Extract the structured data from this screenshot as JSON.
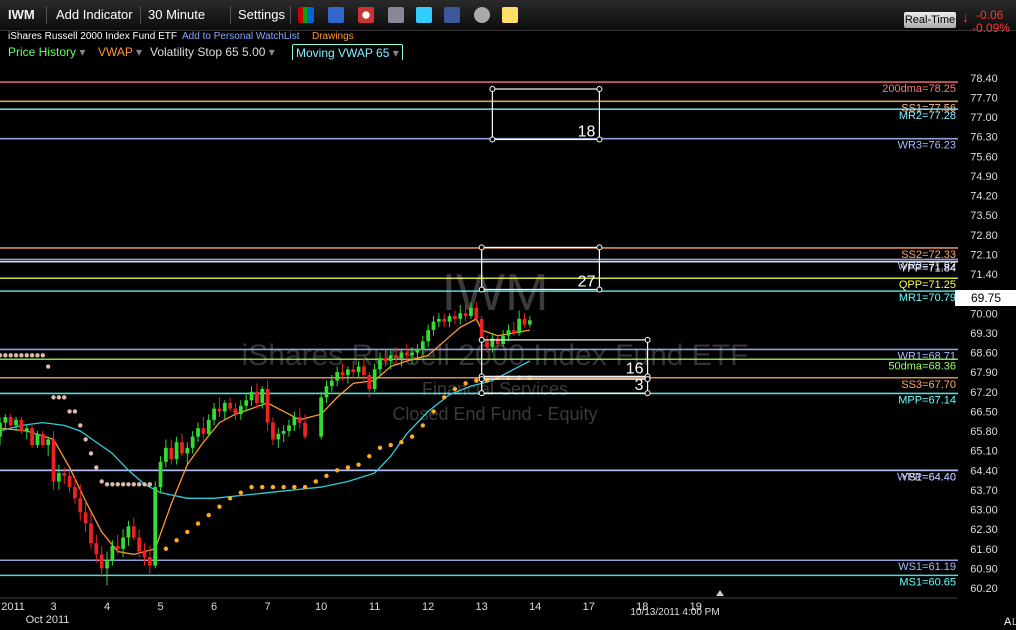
{
  "toolbar": {
    "symbol": "IWM",
    "add_indicator": "Add Indicator",
    "interval": "30 Minute",
    "settings": "Settings",
    "realtime": "Real-Time",
    "change_abs": "-0.06",
    "change_pct": "-0.09%"
  },
  "subheader": {
    "fund_name": "iShares Russell 2000 Index Fund ETF",
    "watchlist_link": "Add to Personal WatchList",
    "drawings_link": "Drawings"
  },
  "indicators": [
    {
      "label": "Price History",
      "color": "#66ff66"
    },
    {
      "label": "VWAP",
      "color": "#ff9933"
    },
    {
      "label": "Volatility Stop 65 5.00",
      "color": "#dddddd"
    },
    {
      "label": "Moving VWAP 65",
      "color": "#88eeff"
    }
  ],
  "watermark": {
    "symbol": "IWM",
    "name": "iShares Russell 2000 Index Fund ETF",
    "sector": "Financial Services",
    "industry": "Closed End Fund - Equity"
  },
  "cursor_time": "10/13/2011 4:00 PM",
  "chart_data": {
    "type": "candlestick",
    "y_range": [
      60.2,
      78.75
    ],
    "y_ticks": [
      78.4,
      77.7,
      77.0,
      76.3,
      75.6,
      74.9,
      74.2,
      73.5,
      72.8,
      72.1,
      71.4,
      70.7,
      70.0,
      69.3,
      68.6,
      67.9,
      67.2,
      66.5,
      65.8,
      65.1,
      64.4,
      63.7,
      63.0,
      62.3,
      61.6,
      60.9,
      60.2
    ],
    "x_range": [
      2.0,
      19.9
    ],
    "x_ticks": [
      {
        "x": 2.02,
        "label": "2011"
      },
      {
        "x": 3,
        "label": "3"
      },
      {
        "x": 3.0,
        "label": "Oct 2011"
      },
      {
        "x": 4,
        "label": "4"
      },
      {
        "x": 5,
        "label": "5"
      },
      {
        "x": 6,
        "label": "6"
      },
      {
        "x": 7,
        "label": "7"
      },
      {
        "x": 8,
        "label": "10"
      },
      {
        "x": 9,
        "label": "11"
      },
      {
        "x": 10,
        "label": "12"
      },
      {
        "x": 11,
        "label": "13"
      },
      {
        "x": 12,
        "label": "14"
      },
      {
        "x": 13,
        "label": "17"
      },
      {
        "x": 14,
        "label": "18"
      },
      {
        "x": 15,
        "label": "19"
      }
    ],
    "last_price": "69.75",
    "levels": [
      {
        "label": "200dma=78.25",
        "value": 78.25,
        "color": "#ff7777"
      },
      {
        "label": "SS1=77.56",
        "value": 77.56,
        "color": "#ffbb88"
      },
      {
        "label": "MR2=77.28",
        "value": 77.28,
        "color": "#88eeff"
      },
      {
        "label": "WR3=76.23",
        "value": 76.23,
        "color": "#aabbff"
      },
      {
        "label": "SS2=72.33",
        "value": 72.33,
        "color": "#ffaa66"
      },
      {
        "label": "WR2=71.92",
        "value": 71.92,
        "color": "#aabbff"
      },
      {
        "label": "YPP=71.84",
        "value": 71.84,
        "color": "#ffffff"
      },
      {
        "label": "QPP=71.25",
        "value": 71.25,
        "color": "#ffff55"
      },
      {
        "label": "MR1=70.79",
        "value": 70.79,
        "color": "#66ffff"
      },
      {
        "label": "WR1=68.71",
        "value": 68.71,
        "color": "#aabbff"
      },
      {
        "label": "50dma=68.36",
        "value": 68.36,
        "color": "#99ff66"
      },
      {
        "label": "SS3=67.70",
        "value": 67.7,
        "color": "#ffaa66"
      },
      {
        "label": "MPP=67.14",
        "value": 67.14,
        "color": "#66ffff"
      },
      {
        "label": "YS1=64.40",
        "value": 64.4,
        "color": "#ffffff"
      },
      {
        "label": "WPP=64.40",
        "value": 64.4,
        "color": "#aabbff"
      },
      {
        "label": "WS1=61.19",
        "value": 61.19,
        "color": "#aabbff"
      },
      {
        "label": "MS1=60.65",
        "value": 60.65,
        "color": "#66ffff"
      }
    ],
    "boxes": [
      {
        "label": "18",
        "x0": 11.2,
        "x1": 13.2,
        "y0": 76.2,
        "y1": 78.0
      },
      {
        "label": "27",
        "x0": 11.0,
        "x1": 13.2,
        "y0": 70.85,
        "y1": 72.35
      },
      {
        "label": "16",
        "x0": 11.0,
        "x1": 14.1,
        "y0": 67.75,
        "y1": 69.05
      },
      {
        "label": "3",
        "x0": 11.0,
        "x1": 14.1,
        "y0": 67.15,
        "y1": 67.65
      }
    ],
    "candles": [
      [
        2.0,
        65.6,
        66.3,
        65.3,
        66.1
      ],
      [
        2.1,
        66.1,
        66.4,
        65.9,
        66.3
      ],
      [
        2.2,
        66.3,
        66.4,
        65.9,
        66.0
      ],
      [
        2.3,
        66.0,
        66.3,
        65.8,
        66.2
      ],
      [
        2.4,
        66.2,
        66.3,
        65.7,
        65.8
      ],
      [
        2.5,
        65.8,
        66.0,
        65.5,
        65.9
      ],
      [
        2.6,
        65.9,
        66.0,
        65.2,
        65.3
      ],
      [
        2.7,
        65.3,
        65.8,
        65.2,
        65.7
      ],
      [
        2.8,
        65.7,
        65.8,
        65.2,
        65.3
      ],
      [
        2.9,
        65.3,
        65.6,
        64.9,
        65.5
      ],
      [
        3.0,
        65.5,
        65.8,
        63.7,
        64.0
      ],
      [
        3.1,
        64.0,
        64.6,
        63.7,
        64.3
      ],
      [
        3.2,
        64.3,
        64.5,
        63.9,
        64.2
      ],
      [
        3.3,
        64.2,
        64.4,
        63.6,
        63.8
      ],
      [
        3.4,
        63.8,
        64.2,
        63.2,
        63.4
      ],
      [
        3.5,
        63.4,
        63.9,
        62.6,
        62.9
      ],
      [
        3.6,
        62.9,
        63.3,
        62.2,
        62.5
      ],
      [
        3.7,
        62.5,
        62.9,
        61.6,
        61.8
      ],
      [
        3.8,
        61.8,
        62.1,
        61.1,
        61.4
      ],
      [
        3.9,
        61.4,
        61.7,
        60.6,
        60.9
      ],
      [
        4.0,
        60.9,
        61.5,
        60.3,
        61.2
      ],
      [
        4.1,
        61.2,
        61.9,
        61.0,
        61.7
      ],
      [
        4.2,
        61.7,
        62.1,
        61.4,
        61.6
      ],
      [
        4.3,
        61.6,
        62.3,
        61.3,
        62.0
      ],
      [
        4.4,
        62.0,
        62.6,
        61.7,
        62.4
      ],
      [
        4.5,
        62.4,
        62.7,
        61.9,
        62.0
      ],
      [
        4.6,
        62.0,
        62.3,
        61.3,
        61.5
      ],
      [
        4.7,
        61.5,
        61.8,
        61.0,
        61.3
      ],
      [
        4.8,
        61.3,
        61.7,
        60.7,
        61.0
      ],
      [
        4.9,
        61.0,
        64.0,
        60.9,
        63.8
      ],
      [
        5.0,
        63.8,
        64.9,
        63.6,
        64.7
      ],
      [
        5.1,
        64.7,
        65.5,
        64.5,
        65.2
      ],
      [
        5.2,
        65.2,
        65.5,
        64.6,
        64.8
      ],
      [
        5.3,
        64.8,
        65.6,
        64.6,
        65.4
      ],
      [
        5.4,
        65.4,
        65.7,
        64.9,
        65.0
      ],
      [
        5.5,
        65.0,
        65.4,
        64.6,
        65.2
      ],
      [
        5.6,
        65.2,
        65.8,
        65.0,
        65.6
      ],
      [
        5.7,
        65.6,
        66.1,
        65.4,
        65.9
      ],
      [
        5.8,
        65.9,
        66.3,
        65.5,
        65.7
      ],
      [
        5.9,
        65.7,
        66.4,
        65.6,
        66.2
      ],
      [
        6.0,
        66.2,
        66.8,
        66.0,
        66.6
      ],
      [
        6.1,
        66.6,
        67.0,
        66.3,
        66.5
      ],
      [
        6.2,
        66.5,
        66.9,
        66.2,
        66.8
      ],
      [
        6.3,
        66.8,
        67.0,
        66.5,
        66.6
      ],
      [
        6.4,
        66.6,
        66.8,
        66.2,
        66.4
      ],
      [
        6.5,
        66.4,
        66.9,
        66.2,
        66.7
      ],
      [
        6.6,
        66.7,
        67.1,
        66.5,
        66.9
      ],
      [
        6.7,
        66.9,
        67.4,
        66.7,
        67.2
      ],
      [
        6.8,
        67.2,
        67.5,
        66.6,
        66.8
      ],
      [
        6.9,
        66.8,
        67.4,
        66.6,
        67.3
      ],
      [
        7.0,
        67.3,
        67.6,
        65.8,
        66.1
      ],
      [
        7.1,
        66.1,
        66.3,
        65.3,
        65.5
      ],
      [
        7.2,
        65.5,
        65.9,
        65.2,
        65.7
      ],
      [
        7.3,
        65.7,
        66.0,
        65.4,
        65.8
      ],
      [
        7.4,
        65.8,
        66.2,
        65.6,
        66.0
      ],
      [
        7.5,
        66.0,
        66.5,
        65.8,
        66.3
      ],
      [
        7.6,
        66.3,
        66.6,
        65.9,
        66.1
      ],
      [
        7.7,
        66.1,
        66.4,
        65.5,
        65.6
      ],
      [
        8.0,
        65.6,
        67.2,
        65.5,
        67.0
      ],
      [
        8.1,
        67.0,
        67.6,
        66.8,
        67.4
      ],
      [
        8.2,
        67.4,
        67.8,
        67.2,
        67.6
      ],
      [
        8.3,
        67.6,
        68.1,
        67.4,
        67.9
      ],
      [
        8.4,
        67.9,
        68.2,
        67.6,
        67.8
      ],
      [
        8.5,
        67.8,
        68.1,
        67.5,
        68.0
      ],
      [
        8.6,
        68.0,
        68.3,
        67.7,
        67.9
      ],
      [
        8.7,
        67.9,
        68.3,
        67.7,
        68.1
      ],
      [
        8.8,
        68.1,
        68.4,
        67.6,
        67.8
      ],
      [
        8.9,
        67.8,
        67.9,
        67.0,
        67.3
      ],
      [
        9.0,
        67.3,
        68.2,
        67.2,
        68.0
      ],
      [
        9.1,
        68.0,
        68.6,
        67.8,
        68.4
      ],
      [
        9.2,
        68.4,
        68.7,
        68.1,
        68.3
      ],
      [
        9.3,
        68.3,
        68.7,
        68.0,
        68.5
      ],
      [
        9.4,
        68.5,
        68.8,
        68.2,
        68.4
      ],
      [
        9.5,
        68.4,
        68.7,
        68.1,
        68.6
      ],
      [
        9.6,
        68.6,
        68.9,
        68.3,
        68.5
      ],
      [
        9.7,
        68.5,
        68.8,
        68.2,
        68.6
      ],
      [
        9.8,
        68.6,
        68.9,
        68.4,
        68.7
      ],
      [
        9.9,
        68.7,
        69.2,
        68.5,
        69.0
      ],
      [
        10.0,
        69.0,
        69.6,
        68.8,
        69.4
      ],
      [
        10.1,
        69.4,
        69.9,
        69.2,
        69.7
      ],
      [
        10.2,
        69.7,
        70.0,
        69.5,
        69.8
      ],
      [
        10.3,
        69.8,
        70.0,
        69.5,
        69.7
      ],
      [
        10.4,
        69.7,
        70.0,
        69.5,
        69.9
      ],
      [
        10.5,
        69.9,
        70.1,
        69.6,
        69.8
      ],
      [
        10.6,
        69.8,
        70.3,
        69.6,
        70.0
      ],
      [
        10.7,
        70.0,
        70.3,
        69.7,
        69.9
      ],
      [
        10.8,
        69.9,
        70.4,
        69.8,
        70.2
      ],
      [
        10.9,
        70.2,
        70.4,
        69.7,
        69.8
      ],
      [
        11.0,
        69.8,
        69.9,
        68.7,
        69.0
      ],
      [
        11.1,
        69.0,
        69.2,
        68.6,
        68.8
      ],
      [
        11.2,
        68.8,
        69.3,
        68.6,
        69.1
      ],
      [
        11.3,
        69.1,
        69.2,
        68.7,
        68.9
      ],
      [
        11.4,
        68.9,
        69.4,
        68.8,
        69.2
      ],
      [
        11.5,
        69.2,
        69.6,
        69.0,
        69.4
      ],
      [
        11.6,
        69.4,
        69.7,
        69.2,
        69.3
      ],
      [
        11.7,
        69.3,
        70.1,
        69.2,
        69.8
      ],
      [
        11.8,
        69.8,
        70.0,
        69.5,
        69.6
      ],
      [
        11.9,
        69.6,
        69.9,
        69.5,
        69.75
      ]
    ],
    "series": [
      {
        "type": "line",
        "color": "#ff9933",
        "x": [
          2,
          2.5,
          3,
          3.3,
          3.6,
          3.9,
          4.2,
          4.5,
          4.9,
          5.2,
          5.5,
          5.8,
          6.1,
          6.4,
          6.7,
          7,
          7.3,
          7.6,
          8,
          8.3,
          8.6,
          9,
          9.3,
          9.6,
          10,
          10.3,
          10.6,
          10.9,
          11,
          11.3,
          11.6,
          11.9
        ],
        "y": [
          65.9,
          65.8,
          65.5,
          64.5,
          63.3,
          62.2,
          61.5,
          61.4,
          61.6,
          63.2,
          64.6,
          65.4,
          66.1,
          66.4,
          66.6,
          66.8,
          66.5,
          66.2,
          66.4,
          67.0,
          67.5,
          67.6,
          68.1,
          68.3,
          68.5,
          69.0,
          69.5,
          69.8,
          69.4,
          69.2,
          69.3,
          69.4
        ]
      },
      {
        "type": "line",
        "color": "#33ccdd",
        "x": [
          2,
          2.4,
          2.8,
          3.2,
          3.5,
          3.8,
          4.1,
          4.4,
          4.7,
          5,
          5.5,
          6,
          6.5,
          7,
          7.5,
          8,
          8.5,
          9,
          9.3,
          9.6,
          10,
          10.4,
          10.8,
          11.2,
          11.6,
          11.9
        ],
        "y": [
          65.8,
          66.0,
          66.1,
          66.0,
          65.8,
          65.4,
          65.0,
          64.4,
          63.9,
          63.6,
          63.4,
          63.4,
          63.5,
          63.6,
          63.7,
          63.8,
          64.0,
          64.3,
          64.9,
          65.7,
          66.5,
          67.1,
          67.4,
          67.6,
          68.0,
          68.3
        ]
      },
      {
        "type": "dots",
        "color": "#ddbbaa",
        "x": [
          2,
          2.1,
          2.2,
          2.3,
          2.4,
          2.5,
          2.6,
          2.7,
          2.8,
          2.9,
          3.0,
          3.1,
          3.2,
          3.3,
          3.4,
          3.5,
          3.6,
          3.7,
          3.8,
          3.9,
          4.0,
          4.1,
          4.2,
          4.3,
          4.4,
          4.5,
          4.6,
          4.7,
          4.8
        ],
        "y": [
          68.5,
          68.5,
          68.5,
          68.5,
          68.5,
          68.5,
          68.5,
          68.5,
          68.5,
          68.1,
          67.0,
          67.0,
          67.0,
          66.5,
          66.5,
          66.0,
          65.5,
          65.0,
          64.5,
          64.0,
          63.9,
          63.9,
          63.9,
          63.9,
          63.9,
          63.9,
          63.9,
          63.9,
          63.9
        ]
      },
      {
        "type": "dots",
        "color": "#ffaa22",
        "x": [
          4.9,
          5.1,
          5.3,
          5.5,
          5.7,
          5.9,
          6.1,
          6.3,
          6.5,
          6.7,
          6.9,
          7.1,
          7.3,
          7.5,
          7.7,
          7.9,
          8.1,
          8.3,
          8.5,
          8.7,
          8.9,
          9.1,
          9.3,
          9.5,
          9.7,
          9.9,
          10.1,
          10.3,
          10.5,
          10.7,
          10.9,
          11.1,
          11.3,
          11.5,
          11.7,
          11.9
        ],
        "y": [
          61.3,
          61.6,
          61.9,
          62.2,
          62.5,
          62.8,
          63.1,
          63.4,
          63.6,
          63.8,
          63.8,
          63.8,
          63.8,
          63.8,
          63.8,
          64.0,
          64.2,
          64.4,
          64.5,
          64.6,
          64.9,
          65.2,
          65.3,
          65.4,
          65.6,
          66.0,
          66.5,
          67.0,
          67.3,
          67.5,
          67.6,
          67.6,
          67.7,
          67.7,
          67.7,
          67.7
        ]
      }
    ]
  }
}
